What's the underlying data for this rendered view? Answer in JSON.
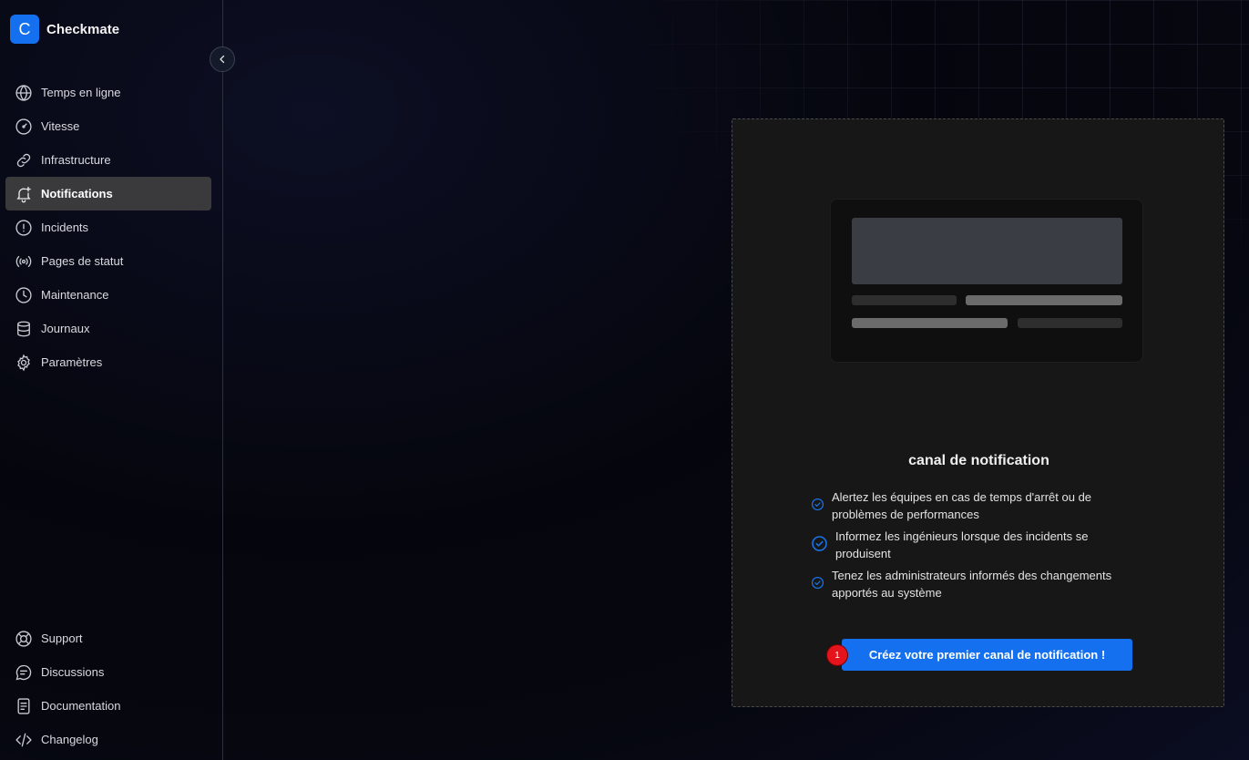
{
  "brand": {
    "logo_letter": "C",
    "name": "Checkmate",
    "accent": "#1570ef"
  },
  "sidebar": {
    "collapse_icon": "chevron-left-icon",
    "items": [
      {
        "label": "Temps en ligne",
        "icon": "globe-icon"
      },
      {
        "label": "Vitesse",
        "icon": "gauge-icon"
      },
      {
        "label": "Infrastructure",
        "icon": "link-icon"
      },
      {
        "label": "Notifications",
        "icon": "bell-plus-icon",
        "active": true
      },
      {
        "label": "Incidents",
        "icon": "alert-circle-icon"
      },
      {
        "label": "Pages de statut",
        "icon": "broadcast-icon"
      },
      {
        "label": "Maintenance",
        "icon": "clock-icon"
      },
      {
        "label": "Journaux",
        "icon": "database-icon"
      },
      {
        "label": "Paramètres",
        "icon": "gear-icon"
      }
    ],
    "bottom_items": [
      {
        "label": "Support",
        "icon": "lifebuoy-icon"
      },
      {
        "label": "Discussions",
        "icon": "chat-icon"
      },
      {
        "label": "Documentation",
        "icon": "document-icon"
      },
      {
        "label": "Changelog",
        "icon": "code-icon"
      }
    ]
  },
  "main": {
    "title": "canal de notification",
    "features": [
      "Alertez les équipes en cas de temps d'arrêt ou de problèmes de performances",
      "Informez les ingénieurs lorsque des incidents se produisent",
      "Tenez les administrateurs informés des changements apportés au système"
    ],
    "feature_icon": "check-circle-icon",
    "cta_label": "Créez votre premier canal de notification !",
    "badge": "1"
  }
}
